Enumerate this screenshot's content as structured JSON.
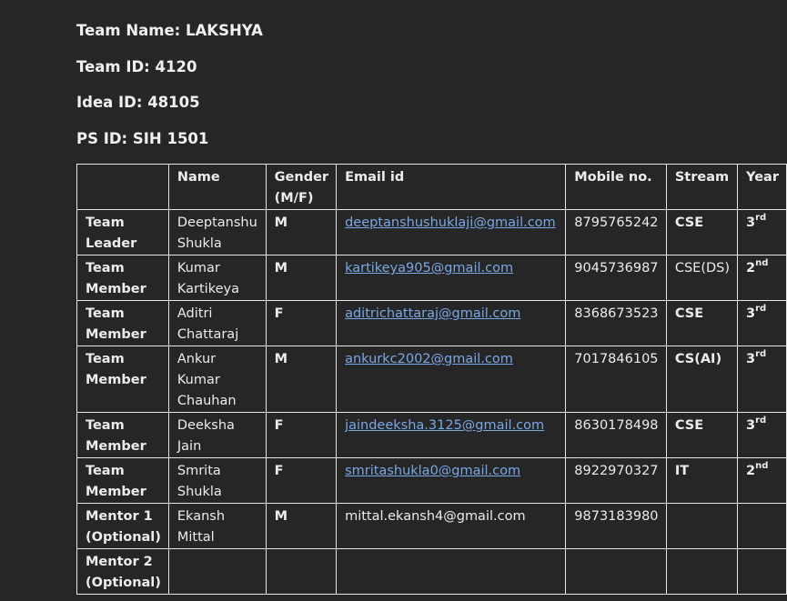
{
  "info": {
    "team_name": "Team Name: LAKSHYA",
    "team_id": "Team ID: 4120",
    "idea_id": "Idea ID: 48105",
    "ps_id": "PS ID: SIH 1501"
  },
  "table": {
    "headers": [
      "",
      "Name",
      "Gender (M/F)",
      "Email id",
      "Mobile no.",
      "Stream",
      "Year"
    ],
    "rows": [
      {
        "role": "Team Leader",
        "name": "Deeptanshu Shukla",
        "gender": "M",
        "email": "deeptanshushuklaji@gmail.com",
        "email_link": true,
        "mobile": "8795765242",
        "stream": "CSE",
        "stream_bold": true,
        "year": "3",
        "year_suffix": "rd"
      },
      {
        "role": "Team Member",
        "name": "Kumar Kartikeya",
        "gender": "M",
        "email": "kartikeya905@gmail.com",
        "email_link": true,
        "mobile": "9045736987",
        "stream": "CSE(DS)",
        "stream_bold": false,
        "year": "2",
        "year_suffix": "nd"
      },
      {
        "role": "Team Member",
        "name": "Aditri Chattaraj",
        "gender": "F",
        "email": "aditrichattaraj@gmail.com",
        "email_link": true,
        "mobile": "8368673523",
        "stream": "CSE",
        "stream_bold": true,
        "year": "3",
        "year_suffix": "rd"
      },
      {
        "role": "Team Member",
        "name": "Ankur Kumar Chauhan",
        "gender": "M",
        "email": "ankurkc2002@gmail.com",
        "email_link": true,
        "mobile": "7017846105",
        "stream": "CS(AI)",
        "stream_bold": true,
        "year": "3",
        "year_suffix": "rd"
      },
      {
        "role": "Team Member",
        "name": "Deeksha Jain",
        "gender": "F",
        "email": "jaindeeksha.3125@gmail.com",
        "email_link": true,
        "mobile": "8630178498",
        "stream": "CSE",
        "stream_bold": true,
        "year": "3",
        "year_suffix": "rd"
      },
      {
        "role": "Team Member",
        "name": "Smrita Shukla",
        "gender": "F",
        "email": "smritashukla0@gmail.com",
        "email_link": true,
        "mobile": "8922970327",
        "stream": "IT",
        "stream_bold": true,
        "year": "2",
        "year_suffix": "nd"
      },
      {
        "role": "Mentor 1 (Optional)",
        "name": "Ekansh Mittal",
        "gender": "M",
        "email": "mittal.ekansh4@gmail.com",
        "email_link": false,
        "mobile": "9873183980",
        "stream": "",
        "stream_bold": false,
        "year": "",
        "year_suffix": ""
      },
      {
        "role": "Mentor 2 (Optional)",
        "name": "",
        "gender": "",
        "email": "",
        "email_link": false,
        "mobile": "",
        "stream": "",
        "stream_bold": false,
        "year": "",
        "year_suffix": ""
      }
    ]
  },
  "colors": {
    "background": "#262626",
    "text": "#ececec",
    "link": "#7aa7e6",
    "border": "#e6e6e6"
  }
}
